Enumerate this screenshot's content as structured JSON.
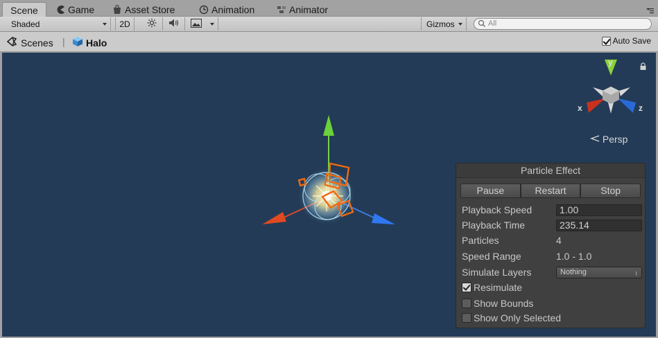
{
  "tabs": [
    {
      "label": "Scene",
      "icon": "scene-icon",
      "active": true
    },
    {
      "label": "Game",
      "icon": "pacman-icon"
    },
    {
      "label": "Asset Store",
      "icon": "store-icon"
    },
    {
      "label": "Animation",
      "icon": "clock-icon"
    },
    {
      "label": "Animator",
      "icon": "animator-icon"
    }
  ],
  "toolbar": {
    "shading": "Shaded",
    "mode_2d": "2D",
    "gizmos": "Gizmos",
    "search_placeholder": "All"
  },
  "breadcrumb": {
    "root": "Scenes",
    "current": "Halo"
  },
  "autosave": {
    "label": "Auto Save",
    "checked": true
  },
  "viewport": {
    "background": "#233b57",
    "persp_label": "Persp",
    "axes": {
      "x": "x",
      "y": "y",
      "z": "z"
    }
  },
  "particle_panel": {
    "title": "Particle Effect",
    "buttons": [
      "Pause",
      "Restart",
      "Stop"
    ],
    "playback_speed": {
      "label": "Playback Speed",
      "value": "1.00"
    },
    "playback_time": {
      "label": "Playback Time",
      "value": "235.14"
    },
    "particles": {
      "label": "Particles",
      "value": "4"
    },
    "speed_range": {
      "label": "Speed Range",
      "value": "1.0 - 1.0"
    },
    "simulate_layers": {
      "label": "Simulate Layers",
      "value": "Nothing"
    },
    "resimulate": {
      "label": "Resimulate",
      "checked": true
    },
    "show_bounds": {
      "label": "Show Bounds",
      "checked": false
    },
    "show_only_selected": {
      "label": "Show Only Selected",
      "checked": false
    }
  }
}
